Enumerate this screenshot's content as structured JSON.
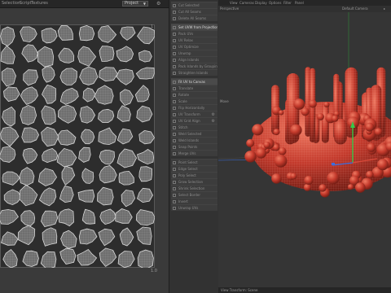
{
  "uv_editor": {
    "menu": [
      "Selection",
      "Script",
      "Textures"
    ],
    "dropdown_value": "Project",
    "axis_top": "1",
    "axis_bottom": "1.0"
  },
  "tools": [
    {
      "label": "Cut Selected"
    },
    {
      "label": "Cut All Seams"
    },
    {
      "label": "Delete All Seams"
    },
    {
      "label": "Set UVW from Projection",
      "active": true,
      "gear": true
    },
    {
      "label": "Pack UVs"
    },
    {
      "label": "UV Relax"
    },
    {
      "label": "UV Optimize"
    },
    {
      "label": "Unwrap"
    },
    {
      "label": "Align Islands"
    },
    {
      "label": "Pack Islands by Grouping"
    },
    {
      "label": "Straighten Islands"
    },
    {
      "label": "Fit UV to Canvas",
      "active": true
    },
    {
      "label": "Translate"
    },
    {
      "label": "Rotate"
    },
    {
      "label": "Scale"
    },
    {
      "label": "Flip Horizontally"
    },
    {
      "label": "UV Transform",
      "gear": true
    },
    {
      "label": "UV Grid Align",
      "gear": true
    },
    {
      "label": "Stitch"
    },
    {
      "label": "Weld Selected"
    },
    {
      "label": "Weld Islands"
    },
    {
      "label": "Snap Points"
    },
    {
      "label": "Merge UVs"
    },
    {
      "label": "Point Select"
    },
    {
      "label": "Edge Select"
    },
    {
      "label": "Poly Select"
    },
    {
      "label": "Grow Selection"
    },
    {
      "label": "Shrink Selection"
    },
    {
      "label": "Select Border"
    },
    {
      "label": "Invert"
    },
    {
      "label": "Unwrap UVs"
    }
  ],
  "viewport": {
    "menu": [
      "View",
      "Cameras",
      "Display",
      "Options",
      "Filter",
      "Panel"
    ],
    "view_label": "Perspective",
    "camera_label": "Default Camera",
    "move_label": "Move",
    "status_text": "View Transform: Scene"
  },
  "colors": {
    "mesh_red": "#c43a2c",
    "island_fill": "#6f6f6f",
    "island_line": "#dcdcdc",
    "axis_y": "#37c84a",
    "axis_x": "#d94a3a",
    "axis_z": "#3a6ee0"
  }
}
